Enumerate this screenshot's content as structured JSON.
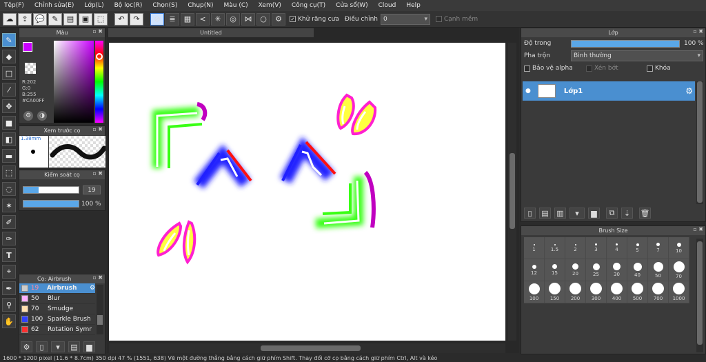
{
  "menu": [
    "Tệp(F)",
    "Chỉnh sửa(E)",
    "Lớp(L)",
    "Bộ lọc(R)",
    "Chọn(S)",
    "Chụp(N)",
    "Màu (C)",
    "Xem(V)",
    "Công cụ(T)",
    "Cửa sổ(W)",
    "Cloud",
    "Help"
  ],
  "toolbar": {
    "antialias_label": "Khử răng cưa",
    "adjust_label": "Điều chỉnh",
    "adjust_value": "0",
    "smooth_label": "Cạnh mềm"
  },
  "color_panel": {
    "title": "Màu",
    "r": "R:202",
    "g": "G:0",
    "b": "B:255",
    "hex": "#CA00FF",
    "fg_color": "#CA00FF"
  },
  "brush_preview": {
    "title": "Xem trước cọ",
    "size": "1.38mm"
  },
  "brush_control": {
    "title": "Kiểm soát cọ",
    "size_value": "19",
    "size_fill": 0.27,
    "opacity_value": "100 %",
    "opacity_fill": 1.0
  },
  "brush_list": {
    "title": "Cọ: Airbrush",
    "items": [
      {
        "size": "19",
        "name": "Airbrush",
        "color": "#cccccc"
      },
      {
        "size": "50",
        "name": "Blur",
        "color": "#ffb0ff"
      },
      {
        "size": "70",
        "name": "Smudge",
        "color": "#ffe0b0"
      },
      {
        "size": "100",
        "name": "Sparkle Brush",
        "color": "#3040ff"
      },
      {
        "size": "62",
        "name": "Rotation Symme",
        "color": "#ff3030"
      }
    ]
  },
  "document": {
    "tab": "Untitled"
  },
  "layer_panel": {
    "title": "Lớp",
    "opacity_label": "Độ trong",
    "opacity_value": "100 %",
    "opacity_fill": 1.0,
    "blend_label": "Pha trộn",
    "blend_value": "Bình thường",
    "protect_alpha": "Bảo vệ alpha",
    "clipping": "Xén bớt",
    "lock": "Khóa",
    "layer_name": "Lớp1"
  },
  "brush_size_panel": {
    "title": "Brush Size",
    "sizes": [
      "1",
      "1.5",
      "2",
      "3",
      "4",
      "5",
      "7",
      "10",
      "12",
      "15",
      "20",
      "25",
      "30",
      "40",
      "50",
      "70",
      "100",
      "150",
      "200",
      "300",
      "400",
      "500",
      "700",
      "1000"
    ]
  },
  "status": "1600 * 1200 pixel  (11.6 * 8.7cm)  350 dpi  47 %  (1551, 638)   Vẽ một đường thẳng bằng cách giữ phím Shift. Thay đổi cỡ cọ bằng cách giữ phím Ctrl, Alt và kéo"
}
